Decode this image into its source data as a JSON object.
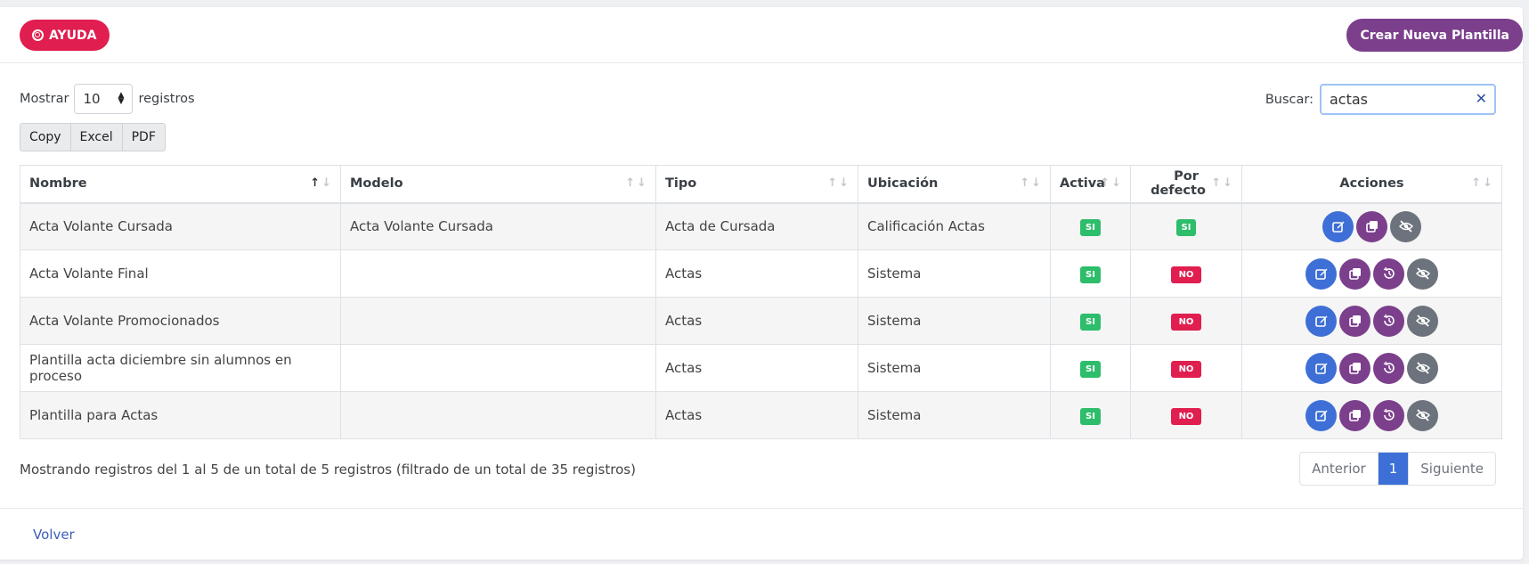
{
  "header": {
    "help_label": "AYUDA",
    "create_label": "Crear Nueva Plantilla"
  },
  "length_control": {
    "prefix": "Mostrar",
    "value": "10",
    "suffix": "registros"
  },
  "search": {
    "label": "Buscar:",
    "value": "actas"
  },
  "export_buttons": [
    "Copy",
    "Excel",
    "PDF"
  ],
  "table": {
    "columns": [
      "Nombre",
      "Modelo",
      "Tipo",
      "Ubicación",
      "Activa",
      "Por defecto",
      "Acciones"
    ],
    "rows": [
      {
        "nombre": "Acta Volante Cursada",
        "modelo": "Acta Volante Cursada",
        "tipo": "Acta de Cursada",
        "ubicacion": "Calificación Actas",
        "activa": "SI",
        "por_defecto": "SI"
      },
      {
        "nombre": "Acta Volante Final",
        "modelo": "",
        "tipo": "Actas",
        "ubicacion": "Sistema",
        "activa": "SI",
        "por_defecto": "NO"
      },
      {
        "nombre": "Acta Volante Promocionados",
        "modelo": "",
        "tipo": "Actas",
        "ubicacion": "Sistema",
        "activa": "SI",
        "por_defecto": "NO"
      },
      {
        "nombre": "Plantilla acta diciembre sin alumnos en proceso",
        "modelo": "",
        "tipo": "Actas",
        "ubicacion": "Sistema",
        "activa": "SI",
        "por_defecto": "NO"
      },
      {
        "nombre": "Plantilla para Actas",
        "modelo": "",
        "tipo": "Actas",
        "ubicacion": "Sistema",
        "activa": "SI",
        "por_defecto": "NO"
      }
    ]
  },
  "info_text": "Mostrando registros del 1 al 5 de un total de 5 registros (filtrado de un total de 35 registros)",
  "pagination": {
    "prev": "Anterior",
    "current": "1",
    "next": "Siguiente"
  },
  "footer": {
    "back_label": "Volver"
  },
  "colors": {
    "help": "#e01e4f",
    "create": "#7b3f8c",
    "edit": "#3d6fd6",
    "yes": "#2ebd6b",
    "no": "#e01e4f",
    "hide": "#6c737c"
  }
}
